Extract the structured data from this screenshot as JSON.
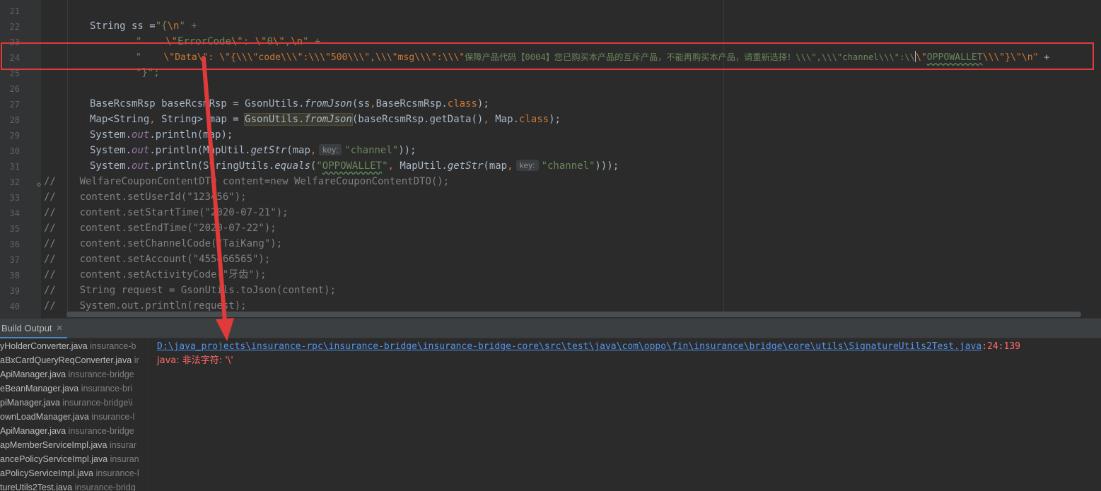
{
  "editor": {
    "line_numbers": [
      "21",
      "22",
      "23",
      "24",
      "25",
      "26",
      "27",
      "28",
      "29",
      "30",
      "31",
      "32",
      "33",
      "34",
      "35",
      "36",
      "37",
      "38",
      "39",
      "40"
    ],
    "code": {
      "l22": {
        "a": "String ss =",
        "b": "\"{",
        "c": "\\n",
        "d": "\" +"
      },
      "l23": {
        "a": "\"    ",
        "b": "\\\"",
        "c": "ErrorCode",
        "d": "\\\"",
        "e": ": ",
        "f": "\\\"",
        "g": "0",
        "h": "\\\"",
        "i": ",",
        "j": "\\n",
        "k": "\" +"
      },
      "l24": {
        "a": "\"    ",
        "b": "\\\"Data\\\": \\\"{\\\\\\\"code\\\\\\\":\\\\\\\"500\\\\\\\",\\\\\\\"msg\\\\\\\":\\\\\\\"",
        "c": "保障产品代码【0004】您已购买本产品的互斥产品，不能再购买本产品，请重新选择！\\\\\\\",\\\\\\\"channel\\\\\\\":\\\\",
        "d": "\\\"",
        "e": "OPPOWALLET",
        "f": "\\\\\\\"}\\\"\\n\"",
        "g": " +"
      },
      "l25": "\"}\";",
      "l27": {
        "a": "BaseRcsmRsp baseRcsmRsp = GsonUtils.",
        "b": "fromJson",
        "c": "(ss",
        "d": ",",
        "e": "BaseRcsmRsp.",
        "f": "class",
        "g": ");"
      },
      "l28": {
        "a": "Map<String",
        "b": ",",
        "c": " String> map = ",
        "d": "GsonUtils.",
        "e": "fromJson",
        "f": "(baseRcsmRsp.getData()",
        "g": ",",
        "h": " Map.",
        "i": "class",
        "j": ");"
      },
      "l29": {
        "a": "System.",
        "b": "out",
        "c": ".println(map);"
      },
      "l30": {
        "a": "System.",
        "b": "out",
        "c": ".println(MapUtil.",
        "d": "getStr",
        "e": "(map",
        "f": ",",
        "g": "key:",
        "h": "\"channel\"",
        "i": "));"
      },
      "l31": {
        "a": "System.",
        "b": "out",
        "c": ".println(StringUtils.",
        "d": "equals",
        "e": "(",
        "f": "\"",
        "g": "OPPOWALLET",
        "h": "\"",
        "i": ",",
        "j": " MapUtil.",
        "k": "getStr",
        "l": "(map",
        "m": ",",
        "n": "key:",
        "o": "\"channel\"",
        "p": ")));"
      },
      "comments": [
        "//    WelfareCouponContentDTO content=new WelfareCouponContentDTO();",
        "//    content.setUserId(\"123456\");",
        "//    content.setStartTime(\"2020-07-21\");",
        "//    content.setEndTime(\"2020-07-22\");",
        "//    content.setChannelCode(\"TaiKang\");",
        "//    content.setAccount(\"455466565\");",
        "//    content.setActivityCode(\"牙齿\");",
        "//    String request = GsonUtils.toJson(content);",
        "//    System.out.println(request);"
      ]
    }
  },
  "build_output": {
    "tab_label": "Build Output",
    "files": [
      {
        "name": "yHolderConverter.java",
        "path": "insurance-b"
      },
      {
        "name": "aBxCardQueryReqConverter.java",
        "path": "ir"
      },
      {
        "name": "ApiManager.java",
        "path": "insurance-bridge"
      },
      {
        "name": "eBeanManager.java",
        "path": "insurance-bri"
      },
      {
        "name": "piManager.java",
        "path": "insurance-bridge\\i"
      },
      {
        "name": "ownLoadManager.java",
        "path": "insurance-l"
      },
      {
        "name": "ApiManager.java",
        "path": "insurance-bridge"
      },
      {
        "name": "apMemberServiceImpl.java",
        "path": "insurar"
      },
      {
        "name": "ancePolicyServiceImpl.java",
        "path": "insuran"
      },
      {
        "name": "aPolicyServiceImpl.java",
        "path": "insurance-l"
      },
      {
        "name": "tureUtils2Test.java",
        "path": "insurance-bridg"
      }
    ],
    "error_path": "D:\\java_projects\\insurance-rpc\\insurance-bridge\\insurance-bridge-core\\src\\test\\java\\com\\oppo\\fin\\insurance\\bridge\\core\\utils\\SignatureUtils2Test.java",
    "error_position": ":24:139",
    "error_message": "java: 非法字符: '\\'"
  },
  "colors": {
    "highlight_box": "#e03a3a",
    "arrow": "#e03a3a",
    "link": "#5394ec",
    "error": "#ff6b68"
  }
}
